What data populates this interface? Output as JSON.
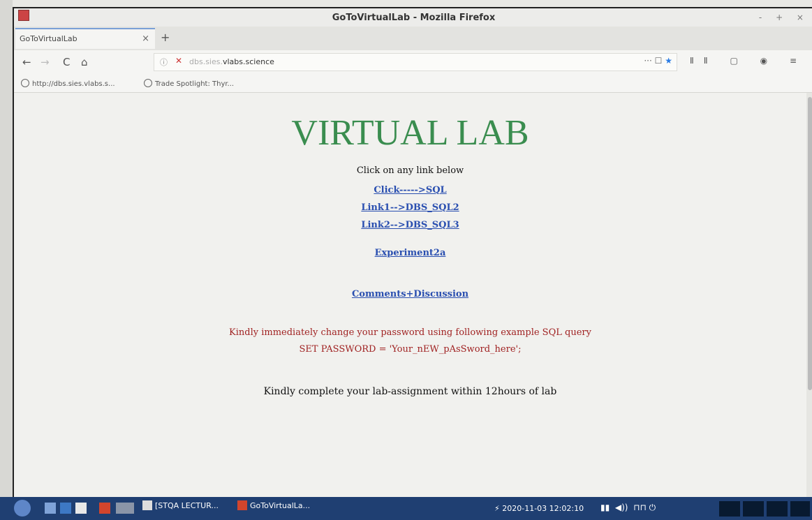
{
  "window": {
    "title": "GoToVirtualLab - Mozilla Firefox",
    "controls": "- + ×"
  },
  "tab": {
    "title": "GoToVirtualLab",
    "close": "×",
    "new_tab": "+"
  },
  "nav": {
    "back": "←",
    "forward": "→",
    "reload": "C",
    "home": "⌂"
  },
  "urlbar": {
    "info": "ⓘ",
    "url_prefix": "dbs.sies.",
    "url_host": "vlabs.science",
    "actions": "···",
    "pocket": "☐"
  },
  "toolbar": {
    "icons": "ⅡⅡ ▢ ◉ ≡"
  },
  "bookmarks": [
    {
      "label": "http://dbs.sies.vlabs.s..."
    },
    {
      "label": "Trade Spotlight: Thyr..."
    }
  ],
  "page": {
    "heading": "VIRTUAL LAB",
    "intro": "Click on any link below",
    "links": [
      "Click----->SQL",
      "Link1-->DBS_SQL2",
      "Link2-->DBS_SQL3",
      "Experiment2a",
      "Comments+Discussion"
    ],
    "warning": "Kindly immediately change your password using following example SQL query",
    "query": "SET PASSWORD = 'Your_nEW_pAsSword_here';",
    "note": "Kindly complete your lab-assignment within 12hours of lab"
  },
  "taskbar": {
    "tasks": [
      "[STQA LECTUR...",
      "GoToVirtualLa..."
    ],
    "clock": "2020-11-03 12:02:10"
  }
}
